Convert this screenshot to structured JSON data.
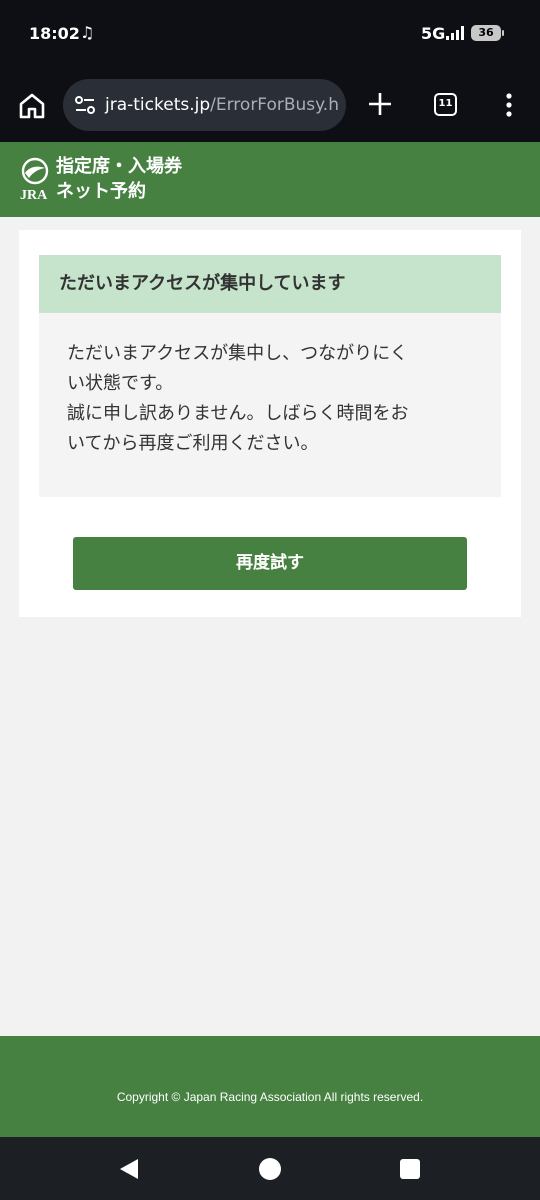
{
  "status_bar": {
    "time": "18:02",
    "network": "5G",
    "battery": "36"
  },
  "browser": {
    "url_domain": "jra-tickets.jp",
    "url_path": "/ErrorForBusy.h",
    "tab_count": "11"
  },
  "site": {
    "logo_text": "JRA",
    "title_line1": "指定席・入場券",
    "title_line2": "ネット予約"
  },
  "message": {
    "heading": "ただいまアクセスが集中しています",
    "line1": "ただいまアクセスが集中し、つながりにく",
    "line2": "い状態です。",
    "line3": "誠に申し訳ありません。しばらく時間をお",
    "line4": "いてから再度ご利用ください。"
  },
  "retry_label": "再度試す",
  "footer": {
    "copyright": "Copyright © Japan Racing Association All rights reserved."
  },
  "colors": {
    "brand_green": "#468142",
    "heading_bg": "#c5e4cb",
    "page_bg": "#f2f2f2"
  }
}
